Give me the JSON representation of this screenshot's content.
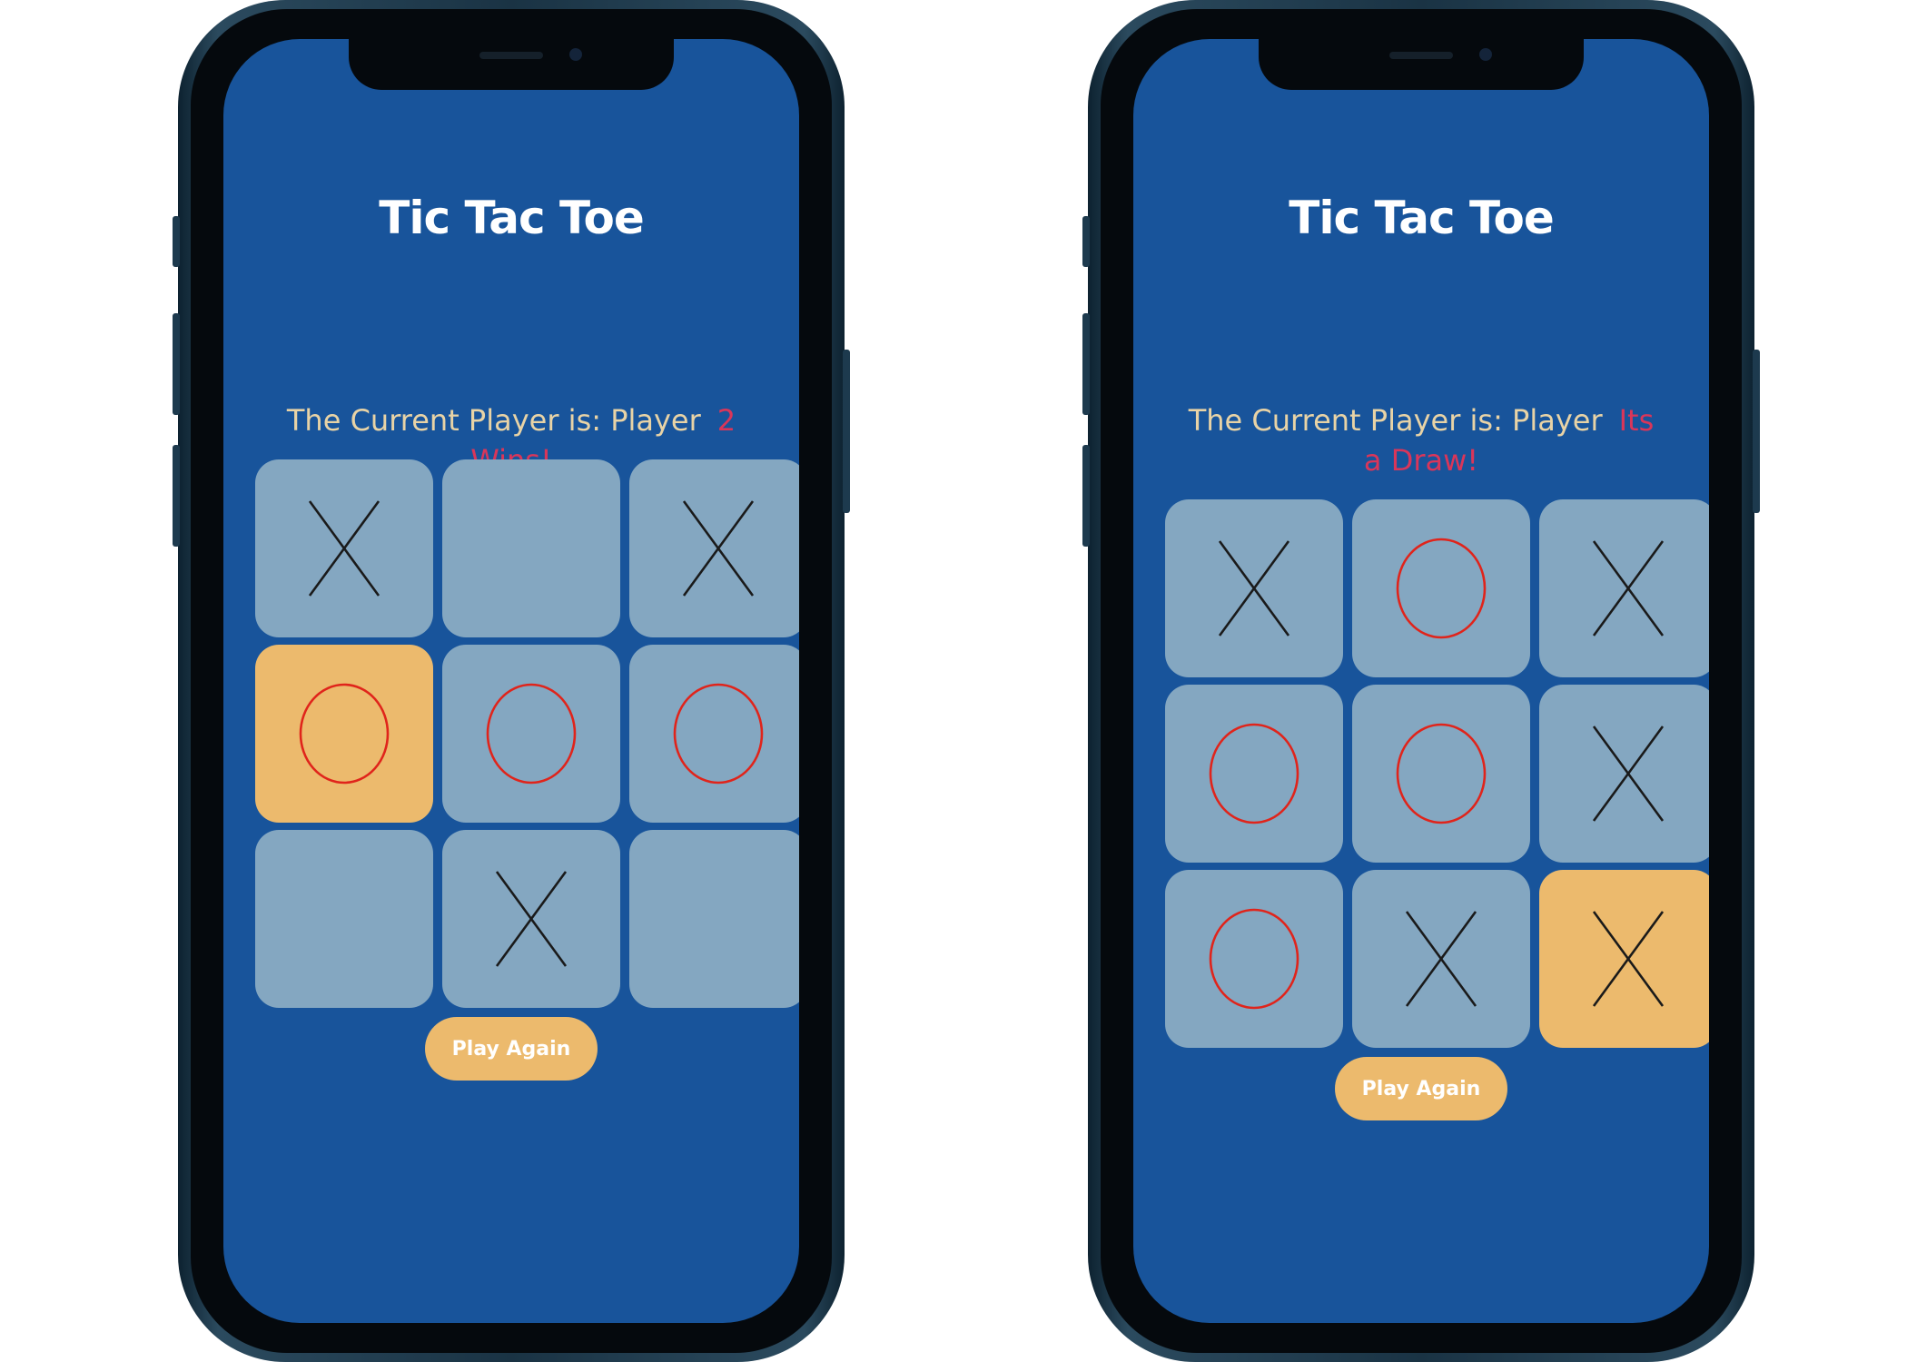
{
  "colors": {
    "screen_background": "#18549b",
    "cell_default": "#84a7c1",
    "cell_highlight": "#ecba6d",
    "x_mark": "#1a1a1a",
    "o_mark": "#e0241b",
    "status_text": "#e8d3a6",
    "result_text": "#d9365a",
    "button": "#ecba6d"
  },
  "left_phone": {
    "title": "Tic Tac Toe",
    "status_prefix": "The Current Player is: Player",
    "status_result": "2 Wins!",
    "board": [
      {
        "mark": "X",
        "highlight": false
      },
      {
        "mark": "",
        "highlight": false
      },
      {
        "mark": "X",
        "highlight": false
      },
      {
        "mark": "O",
        "highlight": true
      },
      {
        "mark": "O",
        "highlight": false
      },
      {
        "mark": "O",
        "highlight": false
      },
      {
        "mark": "",
        "highlight": false
      },
      {
        "mark": "X",
        "highlight": false
      },
      {
        "mark": "",
        "highlight": false
      }
    ],
    "play_again_label": "Play Again"
  },
  "right_phone": {
    "title": "Tic Tac Toe",
    "status_prefix": "The Current Player is: Player",
    "status_result": "Its a Draw!",
    "board": [
      {
        "mark": "X",
        "highlight": false
      },
      {
        "mark": "O",
        "highlight": false
      },
      {
        "mark": "X",
        "highlight": false
      },
      {
        "mark": "O",
        "highlight": false
      },
      {
        "mark": "O",
        "highlight": false
      },
      {
        "mark": "X",
        "highlight": false
      },
      {
        "mark": "O",
        "highlight": false
      },
      {
        "mark": "X",
        "highlight": false
      },
      {
        "mark": "X",
        "highlight": true
      }
    ],
    "play_again_label": "Play Again"
  }
}
